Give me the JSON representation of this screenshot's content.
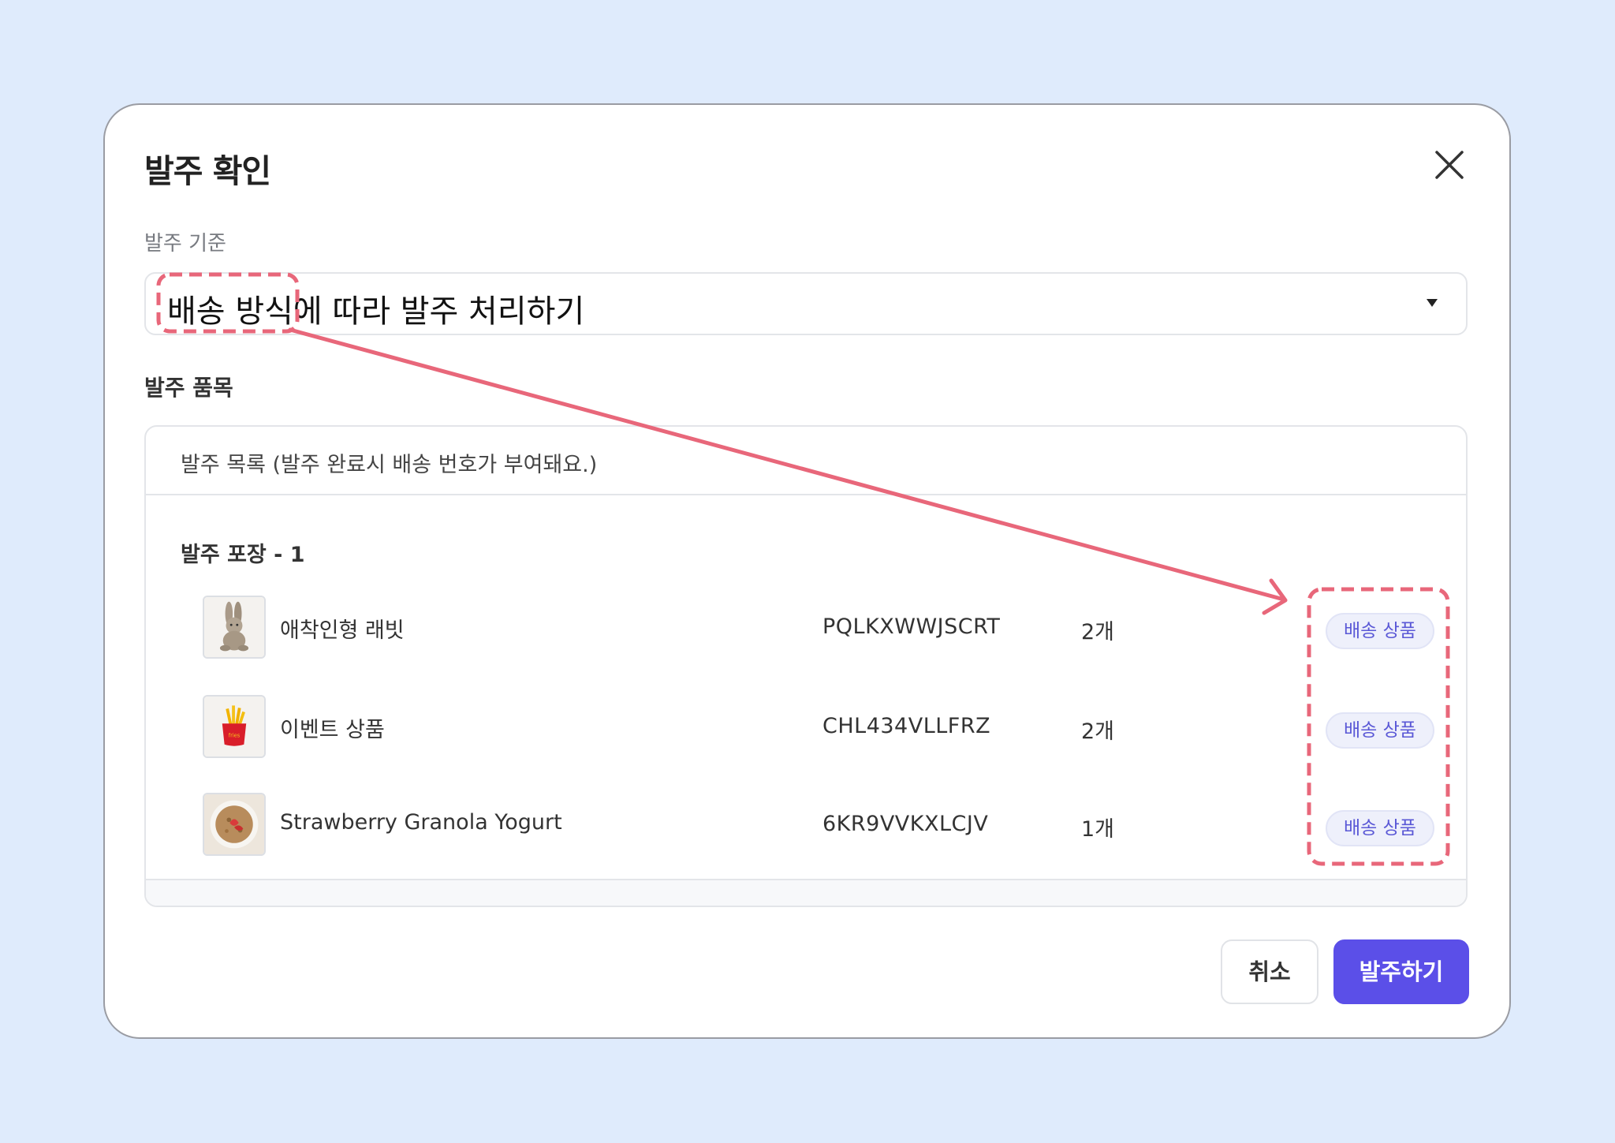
{
  "dialog": {
    "title": "발주 확인",
    "criteria_label": "발주 기준",
    "criteria_value": "배송 방식에 따라 발주 처리하기",
    "items_label": "발주 품목",
    "list_header": "발주 목록 (발주 완료시 배송 번호가 부여돼요.)",
    "group_title": "발주 포장 - 1",
    "items": [
      {
        "name": "애착인형 래빗",
        "code": "PQLKXWWJSCRT",
        "qty": "2개",
        "badge": "배송 상품",
        "thumb_icon": "plush-rabbit-icon"
      },
      {
        "name": "이벤트 상품",
        "code": "CHL434VLLFRZ",
        "qty": "2개",
        "badge": "배송 상품",
        "thumb_icon": "fries-plush-icon"
      },
      {
        "name": "Strawberry Granola Yogurt",
        "code": "6KR9VVKXLCJV",
        "qty": "1개",
        "badge": "배송 상품",
        "thumb_icon": "yogurt-bowl-icon"
      }
    ],
    "cancel_label": "취소",
    "submit_label": "발주하기"
  },
  "colors": {
    "background": "#dfebfc",
    "accent": "#5b4fe8",
    "badge_text": "#5a58d6",
    "annotation": "#e8677a"
  }
}
